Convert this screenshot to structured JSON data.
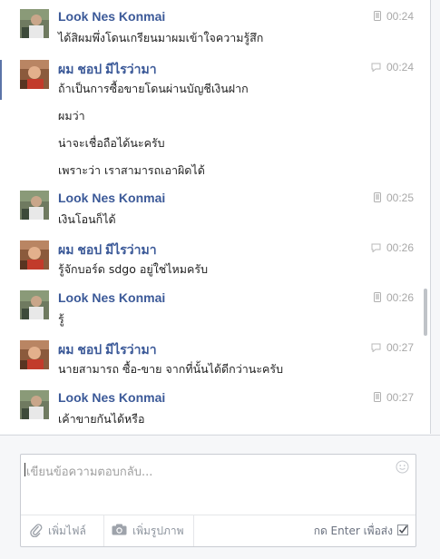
{
  "messages": [
    {
      "author": "Look Nes Konmai",
      "device": "mobile",
      "time": "00:24",
      "lines": [
        "ได้สิผมพึ่งโดนเกรียนมาผมเข้าใจความรู้สึก"
      ]
    },
    {
      "author": "ผม ชอป มีไรว่ามา",
      "device": "chat",
      "time": "00:24",
      "lines": [
        "ถ้าเป็นการซื้อขายโดนผ่านบัญชีเงินฝาก",
        "ผมว่า",
        "น่าจะเชื่อถือได้นะครับ",
        "เพราะว่า เราสามารถเอาผิดได้"
      ]
    },
    {
      "author": "Look Nes Konmai",
      "device": "mobile",
      "time": "00:25",
      "lines": [
        "เงินโอนก็ได้"
      ]
    },
    {
      "author": "ผม ชอป มีไรว่ามา",
      "device": "chat",
      "time": "00:26",
      "lines": [
        "รู้จักบอร์ด sdgo อยู่ใช่ไหมครับ"
      ]
    },
    {
      "author": "Look Nes Konmai",
      "device": "mobile",
      "time": "00:26",
      "lines": [
        "รู้"
      ]
    },
    {
      "author": "ผม ชอป มีไรว่ามา",
      "device": "chat",
      "time": "00:27",
      "lines": [
        "นายสามารถ ซื้อ-ขาย จากที่นั้นได้ดีกว่านะครับ"
      ]
    },
    {
      "author": "Look Nes Konmai",
      "device": "mobile",
      "time": "00:27",
      "lines": [
        "เค้าขายกันได้หรือ"
      ]
    }
  ],
  "composer": {
    "placeholder": "เขียนข้อความตอบกลับ...",
    "attach_label": "เพิ่มไฟล์",
    "photo_label": "เพิ่มรูปภาพ",
    "enter_label": "กด Enter เพื่อส่ง"
  },
  "colors": {
    "author": "#3b5998",
    "meta": "#a8a8a8",
    "text": "#222222"
  },
  "icons": {
    "mobile": "mobile-phone-icon",
    "chat": "chat-bubble-icon",
    "attach": "paperclip-icon",
    "photo": "camera-icon",
    "emoji": "smiley-icon",
    "check": "checkbox-checked-icon"
  }
}
